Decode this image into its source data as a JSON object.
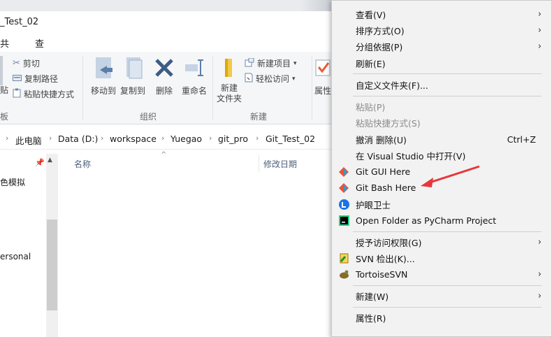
{
  "window": {
    "title": "_Test_02"
  },
  "ribbon": {
    "tabs": [
      "共享",
      "查看"
    ],
    "clipboard": {
      "cut": "剪切",
      "copy_path": "复制路径",
      "paste_shortcut": "粘贴快捷方式",
      "paste_partial": "贴",
      "group": "板"
    },
    "organize": {
      "move_to": "移动到",
      "copy_to": "复制到",
      "delete": "删除",
      "rename": "重命名",
      "group": "组织"
    },
    "new": {
      "new_folder": "新建\n文件夹",
      "new_item": "新建项目",
      "easy_access": "轻松访问",
      "group": "新建"
    },
    "open": {
      "properties_partial": "属性"
    }
  },
  "address": {
    "crumbs": [
      "此电脑",
      "Data (D:)",
      "workspace",
      "Yuegao",
      "git_pro",
      "Git_Test_02"
    ]
  },
  "nav": {
    "items": [
      "色模拟",
      "ersonal"
    ]
  },
  "columns": {
    "name": "名称",
    "modified": "修改日期"
  },
  "menu": {
    "view": "查看(V)",
    "sort": "排序方式(O)",
    "group": "分组依据(P)",
    "refresh": "刷新(E)",
    "customize": "自定义文件夹(F)...",
    "paste": "粘贴(P)",
    "paste_shortcut": "粘贴快捷方式(S)",
    "undo_delete": "撤消 删除(U)",
    "undo_shortcut": "Ctrl+Z",
    "open_vs": "在 Visual Studio 中打开(V)",
    "git_gui": "Git GUI Here",
    "git_bash": "Git Bash Here",
    "eye_care": "护眼卫士",
    "pycharm": "Open Folder as PyCharm Project",
    "grant_access": "授予访问权限(G)",
    "svn_checkout": "SVN 检出(K)...",
    "tortoise": "TortoiseSVN",
    "new": "新建(W)",
    "properties": "属性(R)"
  },
  "colors": {
    "menu_bg": "#f2f2f2",
    "annotation_arrow": "#e8363a",
    "git_orange": "#f05033"
  }
}
